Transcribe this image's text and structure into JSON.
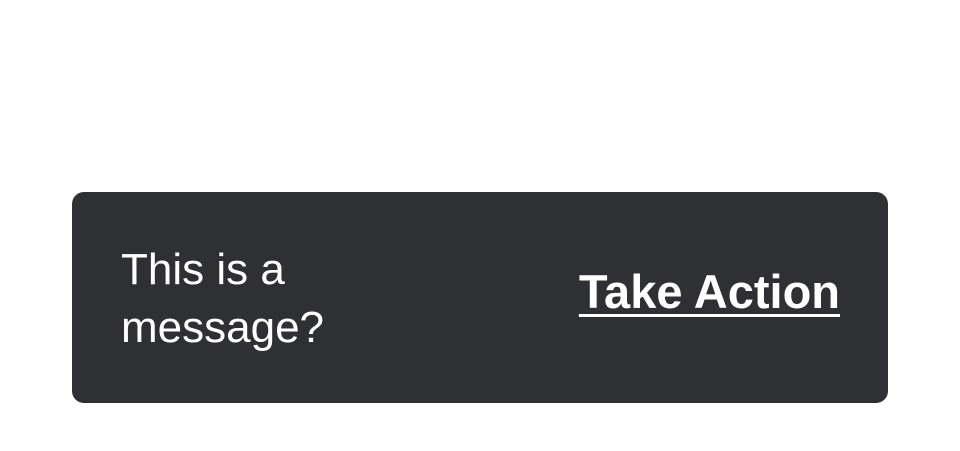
{
  "snackbar": {
    "message": "This is a message?",
    "action_label": "Take Action"
  },
  "colors": {
    "background": "#ffffff",
    "snackbar_background": "#2f3033",
    "text": "#ffffff"
  }
}
